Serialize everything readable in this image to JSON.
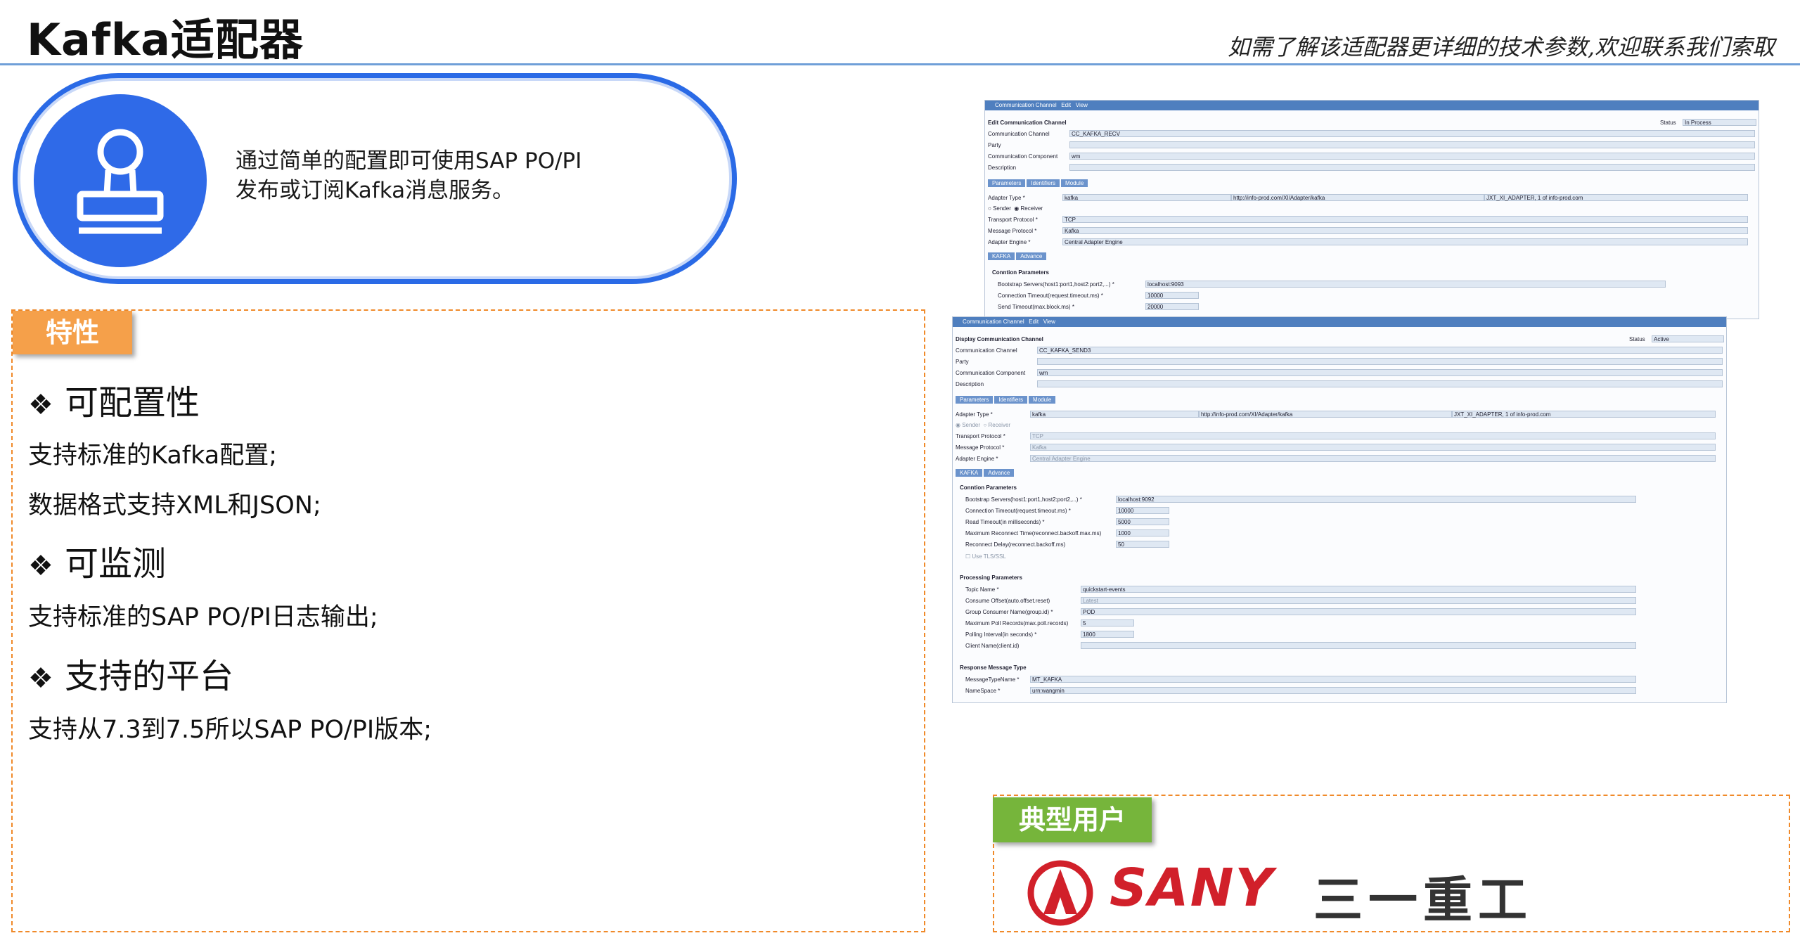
{
  "header": {
    "title": "Kafka适配器",
    "subtitle": "如需了解该适配器更详细的技术参数,欢迎联系我们索取"
  },
  "intro": {
    "icon": "stamp-icon",
    "line1": "通过简单的配置即可使用SAP PO/PI",
    "line2": "发布或订阅Kafka消息服务。"
  },
  "features": {
    "tag": "特性",
    "sections": [
      {
        "heading": "可配置性",
        "lines": [
          "支持标准的Kafka配置;",
          "数据格式支持XML和JSON;"
        ]
      },
      {
        "heading": "可监测",
        "lines": [
          "支持标准的SAP PO/PI日志输出;"
        ]
      },
      {
        "heading": "支持的平台",
        "lines": [
          "支持从7.3到7.5所以SAP PO/PI版本;"
        ]
      }
    ],
    "bullet": "❖"
  },
  "screen1": {
    "menu": [
      "Communication Channel",
      "Edit",
      "View"
    ],
    "heading": "Edit Communication Channel",
    "status_label": "Status",
    "status_value": "In Process",
    "fields": [
      {
        "label": "Communication Channel",
        "value": "CC_KAFKA_RECV"
      },
      {
        "label": "Party",
        "value": ""
      },
      {
        "label": "Communication Component",
        "value": "wm"
      },
      {
        "label": "Description",
        "value": ""
      }
    ],
    "tabs": [
      "Parameters",
      "Identifiers",
      "Module"
    ],
    "adapter_type_label": "Adapter Type *",
    "adapter_type": [
      "kafka",
      "http://info-prod.com/XI/Adapter/kafka",
      "JXT_XI_ADAPTER, 1 of info-prod.com"
    ],
    "sender": "Sender",
    "receiver": "Receiver",
    "proto_fields": [
      {
        "label": "Transport Protocol *",
        "value": "TCP"
      },
      {
        "label": "Message Protocol *",
        "value": "Kafka"
      },
      {
        "label": "Adapter Engine *",
        "value": "Central Adapter Engine"
      }
    ],
    "subtabs": [
      "KAFKA",
      "Advance"
    ],
    "conn_title": "Conntion Parameters",
    "conn_fields": [
      {
        "label": "Bootstrap Servers(host1:port1,host2:port2,...) *",
        "value": "localhost:9093"
      },
      {
        "label": "Connection Timeout(request.timeout.ms) *",
        "value": "10000"
      },
      {
        "label": "Send Timeout(max.block.ms) *",
        "value": "20000"
      }
    ]
  },
  "screen2": {
    "menu": [
      "Communication Channel",
      "Edit",
      "View"
    ],
    "heading": "Display Communication Channel",
    "status_label": "Status",
    "status_value": "Active",
    "fields": [
      {
        "label": "Communication Channel",
        "value": "CC_KAFKA_SEND3"
      },
      {
        "label": "Party",
        "value": ""
      },
      {
        "label": "Communication Component",
        "value": "wm"
      },
      {
        "label": "Description",
        "value": ""
      }
    ],
    "tabs": [
      "Parameters",
      "Identifiers",
      "Module"
    ],
    "adapter_type_label": "Adapter Type *",
    "adapter_type": [
      "kafka",
      "http://info-prod.com/XI/Adapter/kafka",
      "JXT_XI_ADAPTER, 1 of info-prod.com"
    ],
    "sender": "Sender",
    "receiver": "Receiver",
    "proto_fields": [
      {
        "label": "Transport Protocol *",
        "value": "TCP"
      },
      {
        "label": "Message Protocol *",
        "value": "Kafka"
      },
      {
        "label": "Adapter Engine *",
        "value": "Central Adapter Engine"
      }
    ],
    "subtabs": [
      "KAFKA",
      "Advance"
    ],
    "conn_title": "Conntion Parameters",
    "conn_fields": [
      {
        "label": "Bootstrap Servers(host1:port1,host2:port2,...) *",
        "value": "localhost:9092"
      },
      {
        "label": "Connection Timeout(request.timeout.ms) *",
        "value": "10000"
      },
      {
        "label": "Read Timeout(in milliseconds) *",
        "value": "5000"
      },
      {
        "label": "Maximum Reconnect Time(reconnect.backoff.max.ms)",
        "value": "1000"
      },
      {
        "label": "Reconnect Delay(reconnect.backoff.ms)",
        "value": "50"
      }
    ],
    "use_tls": "Use TLS/SSL",
    "proc_title": "Processing Parameters",
    "proc_fields": [
      {
        "label": "Topic Name *",
        "value": "quickstart-events"
      },
      {
        "label": "Consume Offset(auto.offset.reset)",
        "value": "Latest"
      },
      {
        "label": "Group Consumer Name(group.id) *",
        "value": "POD"
      },
      {
        "label": "Maximum Poll Records(max.poll.records)",
        "value": "5"
      },
      {
        "label": "Polling Interval(in seconds) *",
        "value": "1800"
      },
      {
        "label": "Client Name(client.id)",
        "value": ""
      }
    ],
    "resp_title": "Response Message Type",
    "resp_fields": [
      {
        "label": "MessageTypeName *",
        "value": "MT_KAFKA"
      },
      {
        "label": "NameSpace *",
        "value": "urn:wangmin"
      }
    ]
  },
  "users": {
    "tag": "典型用户",
    "brand_word": "SANY",
    "brand_cn": "三一重工",
    "brand_color": "#d1202a"
  }
}
